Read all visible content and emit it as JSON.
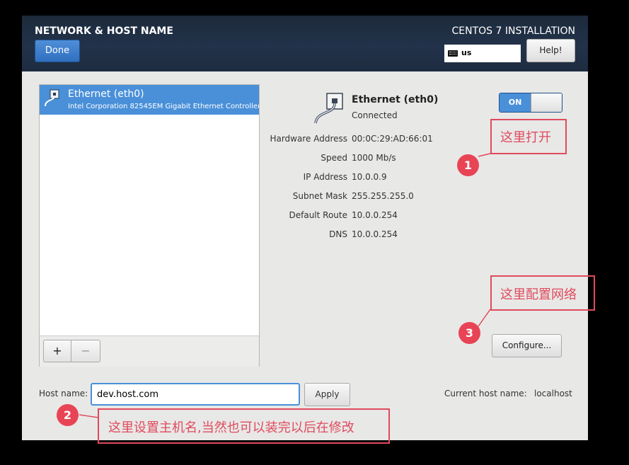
{
  "header": {
    "title": "NETWORK & HOST NAME",
    "done_label": "Done",
    "product_title": "CENTOS 7 INSTALLATION",
    "keyboard_layout": "us",
    "help_label": "Help!"
  },
  "devices": [
    {
      "name": "Ethernet (eth0)",
      "description": "Intel Corporation 82545EM Gigabit Ethernet Controller (",
      "selected": true
    }
  ],
  "device_toolbar": {
    "add_label": "+",
    "remove_label": "−"
  },
  "detail": {
    "name": "Ethernet (eth0)",
    "status": "Connected",
    "switch_label": "ON",
    "switch_on": true,
    "info": [
      {
        "label": "Hardware Address",
        "value": "00:0C:29:AD:66:01"
      },
      {
        "label": "Speed",
        "value": "1000 Mb/s"
      },
      {
        "label": "IP Address",
        "value": "10.0.0.9"
      },
      {
        "label": "Subnet Mask",
        "value": "255.255.255.0"
      },
      {
        "label": "Default Route",
        "value": "10.0.0.254"
      },
      {
        "label": "DNS",
        "value": "10.0.0.254"
      }
    ],
    "configure_label": "Configure..."
  },
  "hostname": {
    "label": "Host name:",
    "value": "dev.host.com",
    "apply_label": "Apply",
    "current_label": "Current host name:",
    "current_value": "localhost"
  },
  "annotations": [
    {
      "number": "1",
      "text": "这里打开"
    },
    {
      "number": "2",
      "text": "这里设置主机名,当然也可以装完以后在修改"
    },
    {
      "number": "3",
      "text": "这里配置网络"
    }
  ],
  "colors": {
    "header_bg": "#1f2d42",
    "accent": "#4a90d9",
    "annotation": "#e04a5c"
  }
}
